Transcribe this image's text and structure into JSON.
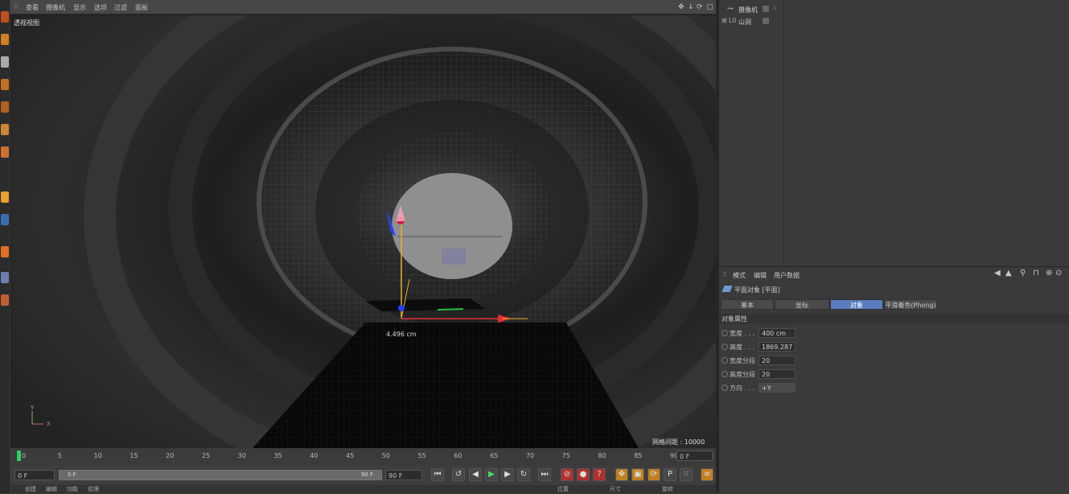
{
  "viewport": {
    "menu": [
      "查看",
      "摄像机",
      "显示",
      "选项",
      "过滤",
      "面板"
    ],
    "view_label": "透视视图",
    "measure_label": "4.496 cm",
    "grid_spacing": "网格间距 : 10000 cm",
    "axis_y": "Y",
    "axis_x": "X"
  },
  "timeline": {
    "ticks": [
      "0",
      "5",
      "10",
      "15",
      "20",
      "25",
      "30",
      "35",
      "40",
      "45",
      "50",
      "55",
      "60",
      "65",
      "70",
      "75",
      "80",
      "85",
      "90"
    ],
    "current_frame": "0 F"
  },
  "transport": {
    "start_field": "0 F",
    "range_start": "0 F",
    "range_end": "90 F",
    "end_field": "90 F"
  },
  "bottom_menu": [
    "创建",
    "编辑",
    "功能",
    "纹理"
  ],
  "bottom_right_menu": [
    "位置",
    "尺寸",
    "旋转"
  ],
  "object_manager": {
    "items": [
      {
        "name": "摄像机"
      },
      {
        "name": "山洞"
      }
    ]
  },
  "attributes": {
    "menu": [
      "模式",
      "编辑",
      "用户数据"
    ],
    "object_title": "平面对象 [平面]",
    "tabs": [
      "基本",
      "坐标",
      "对象",
      "平滑着色(Phong)"
    ],
    "active_tab": "对象",
    "section": "对象属性",
    "props": [
      {
        "label": "宽度 . . .",
        "value": "400 cm"
      },
      {
        "label": "高度 . . .",
        "value": "1869.287"
      },
      {
        "label": "宽度分段",
        "value": "20"
      },
      {
        "label": "高度分段",
        "value": "20"
      },
      {
        "label": "方向 . . .",
        "value": "+Y"
      }
    ]
  },
  "colors": {
    "active_tab": "#5a7dbf",
    "axis_x": "#e03030",
    "axis_y": "#e8b020",
    "axis_z": "#2040ff"
  }
}
